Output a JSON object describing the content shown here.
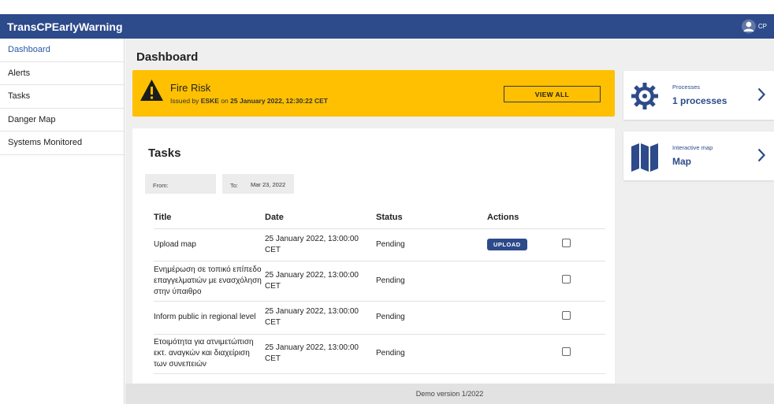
{
  "app": {
    "title": "TransCPEarlyWarning"
  },
  "user": {
    "initials": "CP",
    "icon": "user-avatar-icon"
  },
  "sidebar": {
    "items": [
      {
        "label": "Dashboard",
        "active": true
      },
      {
        "label": "Alerts"
      },
      {
        "label": "Tasks"
      },
      {
        "label": "Danger Map"
      },
      {
        "label": "Systems Monitored"
      }
    ]
  },
  "page": {
    "title": "Dashboard"
  },
  "alert": {
    "icon": "warning-icon",
    "color": "#fec000",
    "title": "Fire Risk",
    "issued_prefix": "Issued by",
    "issuer": "ESKE",
    "issued_on": "on",
    "datetime": "25 January 2022, 12:30:22 CET",
    "view_all_label": "VIEW ALL"
  },
  "tasks": {
    "title": "Tasks",
    "from_label": "From:",
    "from_value": "",
    "to_label": "To:",
    "to_value": "Mar 23, 2022",
    "columns": [
      "Title",
      "Date",
      "Status",
      "Actions"
    ],
    "rows": [
      {
        "title": "Upload map",
        "date": "25 January 2022, 13:00:00 CET",
        "status": "Pending",
        "action_label": "UPLOAD",
        "checked": false
      },
      {
        "title": "Ενημέρωση σε τοπικό επίπεδο επαγγελματιών με ενασχόληση στην ύπαιθρο",
        "date": "25 January 2022, 13:00:00 CET",
        "status": "Pending",
        "checked": false
      },
      {
        "title": "Inform public in regional level",
        "date": "25 January 2022, 13:00:00 CET",
        "status": "Pending",
        "checked": false
      },
      {
        "title": "Ετοιμότητα για ατνιμετώπιση εκτ. αναγκών και διαχείριση των συνεπειών",
        "date": "25 January 2022, 13:00:00 CET",
        "status": "Pending",
        "checked": false
      }
    ]
  },
  "cards": {
    "processes": {
      "caption": "Processes",
      "value": "1 processes",
      "icon": "gear-icon"
    },
    "map": {
      "caption": "Interactive map",
      "value": "Map",
      "icon": "map-icon"
    }
  },
  "footer": {
    "text": "Demo version 1/2022"
  },
  "colors": {
    "primary": "#2d4a8a",
    "accent": "#fec000",
    "background": "#efefef"
  }
}
